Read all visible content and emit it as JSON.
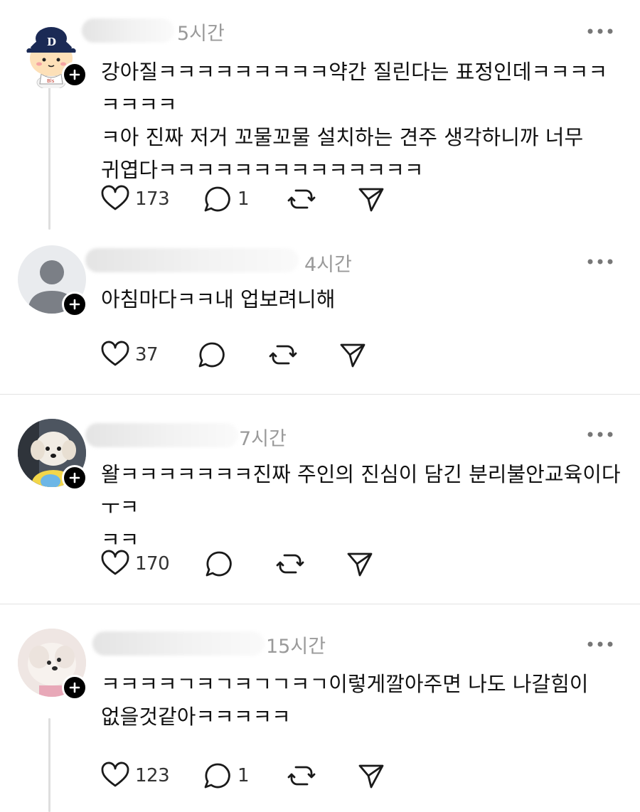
{
  "posts": [
    {
      "time": "5시간",
      "text": "강아질ㅋㅋㅋㅋㅋㅋㅋㅋㅋ약간 질린다는 표정인데ㅋㅋㅋㅋㅋㅋㅋㅋ\nㅋ아 진짜 저거 꼬물꼬물 설치하는 견주 생각하니까 너무\n귀엽다ㅋㅋㅋㅋㅋㅋㅋㅋㅋㅋㅋㅋㅋㅋ",
      "likes": "173",
      "replies": "1",
      "avatar": "baseball-character-avatar"
    },
    {
      "time": "4시간",
      "text": "아침마다ㅋㅋ내 업보려니해",
      "likes": "37",
      "replies": "",
      "avatar": "default-avatar"
    },
    {
      "time": "7시간",
      "text": "왈ㅋㅋㅋㅋㅋㅋㅋ진짜 주인의 진심이 담긴 분리불안교육이다ㅜㅋ\nㅋㅋ",
      "likes": "170",
      "replies": "",
      "avatar": "white-dog-avatar"
    },
    {
      "time": "15시간",
      "text": "ㅋㅋㅋㅋㄱㅋㄱㅋㄱㄱㅋㄱ이렇게깔아주면 나도 나갈힘이\n없을것같아ㅋㅋㅋㅋㅋ",
      "likes": "123",
      "replies": "1",
      "avatar": "fluffy-dog-avatar"
    }
  ],
  "colors": {
    "text": "#111111",
    "muted": "#9a9a9a",
    "separator": "#e2e2e2",
    "icon": "#1a1a1a"
  }
}
